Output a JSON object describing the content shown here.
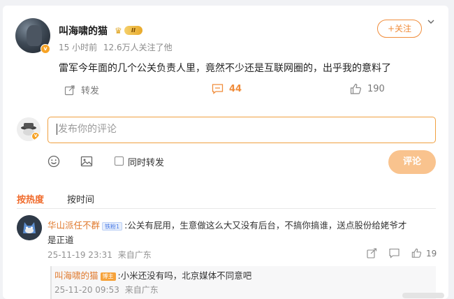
{
  "post": {
    "author": "叫海啸的猫",
    "level": "II",
    "time": "15 小时前",
    "followers": "12.6万人关注了他",
    "follow_label": "+关注",
    "text": "雷军今年面的几个公关负责人里，竟然不少还是互联网圈的，出乎我的意料了",
    "repost_label": "转发",
    "comment_count": "44",
    "like_count": "190"
  },
  "composer": {
    "placeholder": "发布你的评论",
    "also_repost_label": "同时转发",
    "submit_label": "评论"
  },
  "sort": {
    "hot": "按热度",
    "time": "按时间"
  },
  "comments": [
    {
      "user": "华山派任不群",
      "badge": "铁粉1",
      "text_line1": ":公关有屁用，生意做这么大又没有后台，不搞你搞谁，送点股份给姥爷才",
      "text_line2": "是正道",
      "time": "25-11-19 23:31",
      "location": "来自广东",
      "likes": "19",
      "reply": {
        "user": "叫海啸的猫",
        "badge": "博主",
        "text": ":小米还没有吗，北京媒体不同意吧",
        "time": "25-11-20 09:53",
        "location": "来自广东"
      }
    }
  ],
  "icons": {
    "repost": "repost-icon",
    "comment": "comment-icon",
    "like": "thumbs-up-icon",
    "emoji": "emoji-icon",
    "image": "image-icon",
    "share": "share-icon",
    "more": "chevron-down-icon"
  },
  "colors": {
    "accent": "#f08c3a",
    "hot_sort": "#f06a2a",
    "username": "#e07a2e",
    "submit_disabled": "#f9c38e"
  }
}
